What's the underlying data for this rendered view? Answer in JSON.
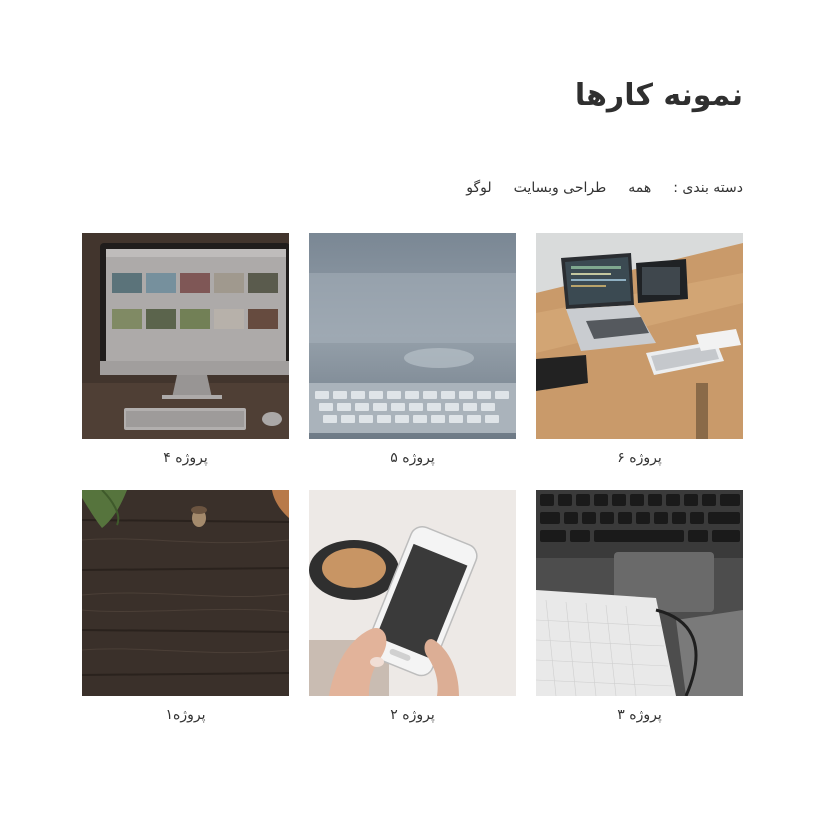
{
  "header": {
    "title": "نمونه کارها"
  },
  "filter": {
    "label": "دسته بندی :",
    "items": [
      "همه",
      "طراحی وبسایت",
      "لوگو"
    ]
  },
  "portfolio": {
    "items": [
      {
        "caption": "پروژه ۶"
      },
      {
        "caption": "پروژه ۵"
      },
      {
        "caption": "پروژه ۴"
      },
      {
        "caption": "پروژه ۳"
      },
      {
        "caption": "پروژه ۲"
      },
      {
        "caption": "پروژه۱"
      }
    ]
  }
}
